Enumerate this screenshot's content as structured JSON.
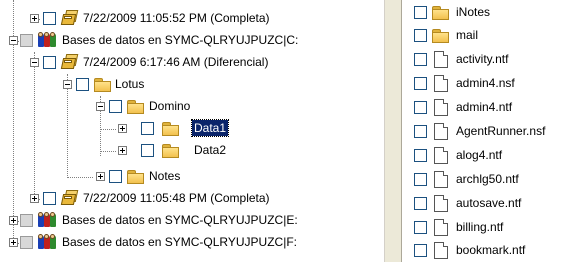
{
  "tree": {
    "rows": [
      {
        "label": "7/22/2009 11:05:52 PM (Completa)",
        "icon": "backup-icon",
        "expander": "plus",
        "checkbox": "white",
        "selected": false
      },
      {
        "label": "Bases de datos en SYMC-QLRYUJPUZC|C:",
        "icon": "database-icon",
        "expander": "minus",
        "checkbox": "grey",
        "selected": false
      },
      {
        "label": "7/24/2009 6:17:46 AM (Diferencial)",
        "icon": "backup-icon",
        "expander": "minus",
        "checkbox": "white",
        "selected": false
      },
      {
        "label": "Lotus",
        "icon": "folder-icon",
        "expander": "minus",
        "checkbox": "white",
        "selected": false
      },
      {
        "label": "Domino",
        "icon": "folder-icon",
        "expander": "minus",
        "checkbox": "white",
        "selected": false
      },
      {
        "label": "Data1",
        "icon": "folder-icon",
        "expander": "plus",
        "checkbox": "white",
        "selected": true
      },
      {
        "label": "Data2",
        "icon": "folder-icon",
        "expander": "plus",
        "checkbox": "white",
        "selected": false
      },
      {
        "label": "Notes",
        "icon": "folder-icon",
        "expander": "plus",
        "checkbox": "white",
        "selected": false
      },
      {
        "label": "7/22/2009 11:05:48 PM (Completa)",
        "icon": "backup-icon",
        "expander": "plus",
        "checkbox": "white",
        "selected": false
      },
      {
        "label": "Bases de datos en SYMC-QLRYUJPUZC|E:",
        "icon": "database-icon",
        "expander": "plus",
        "checkbox": "grey",
        "selected": false
      },
      {
        "label": "Bases de datos en SYMC-QLRYUJPUZC|F:",
        "icon": "database-icon",
        "expander": "plus",
        "checkbox": "grey",
        "selected": false
      }
    ]
  },
  "files": {
    "items": [
      {
        "label": "iNotes",
        "icon": "folder-icon"
      },
      {
        "label": "mail",
        "icon": "folder-icon"
      },
      {
        "label": "activity.ntf",
        "icon": "file-icon"
      },
      {
        "label": "admin4.nsf",
        "icon": "file-icon"
      },
      {
        "label": "admin4.ntf",
        "icon": "file-icon"
      },
      {
        "label": "AgentRunner.nsf",
        "icon": "file-icon"
      },
      {
        "label": "alog4.ntf",
        "icon": "file-icon"
      },
      {
        "label": "archlg50.ntf",
        "icon": "file-icon"
      },
      {
        "label": "autosave.ntf",
        "icon": "file-icon"
      },
      {
        "label": "billing.ntf",
        "icon": "file-icon"
      },
      {
        "label": "bookmark.ntf",
        "icon": "file-icon"
      }
    ]
  },
  "colors": {
    "selection": "#0a246a",
    "folder": "#f2c14e",
    "checkbox_border": "#1c5180"
  }
}
